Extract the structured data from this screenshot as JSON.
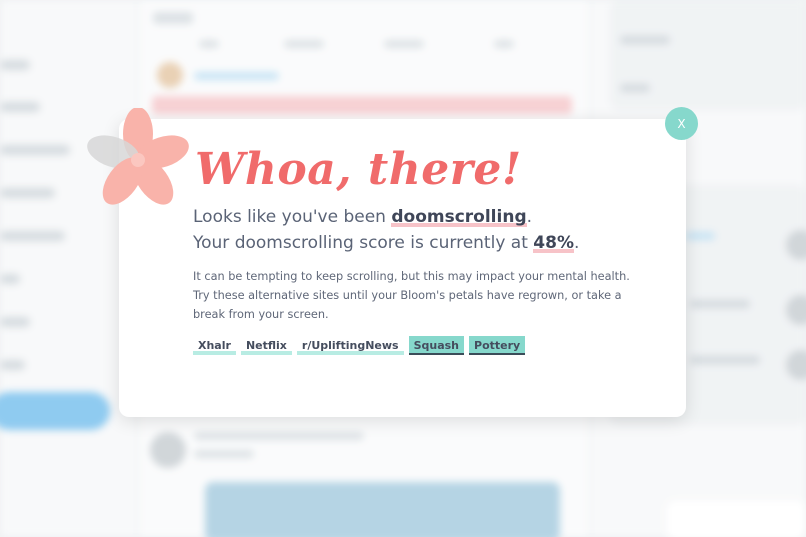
{
  "modal": {
    "title": "Whoa, there!",
    "line1_prefix": "Looks like you've been ",
    "line1_highlight": "doomscrolling",
    "line1_suffix": ".",
    "line2_prefix": "Your doomscrolling score is currently at ",
    "line2_highlight": "48%",
    "line2_suffix": ".",
    "doomscroll_score_percent": 48,
    "paragraph": "It can be tempting to keep scrolling, but this may impact your mental health. Try these alternative sites until your Bloom's petals have regrown, or take a break from your screen.",
    "alternatives": [
      "Xhalr",
      "Netflix",
      "r/UpliftingNews",
      "Squash",
      "Pottery"
    ],
    "close_label": "X"
  },
  "colors": {
    "title": "#f06b6b",
    "highlight_pink": "#f7c3c8",
    "chip_teal": "#86d8cc",
    "close_button": "#86d8cc",
    "flower_petal": "#f9b3aa"
  },
  "icons": {
    "logo": "bloom-flower-icon",
    "close": "close-icon"
  }
}
